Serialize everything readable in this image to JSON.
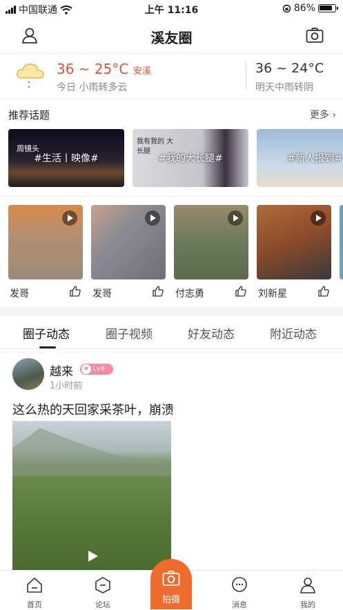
{
  "status": {
    "carrier": "中国联通",
    "time": "上午 11:16",
    "battery": "86%",
    "signal_icon": "signal-bars-icon",
    "wifi_icon": "wifi-icon"
  },
  "nav": {
    "title": "溪友圈"
  },
  "weather": {
    "today_temp": "36 ~ 25°C",
    "city": "安溪",
    "today_desc": "今日 小雨转多云",
    "tomorrow_temp": "36 ~ 24°C",
    "tomorrow_desc": "明天中雨转阴"
  },
  "topics_section": {
    "title": "推荐话题",
    "more": "更多"
  },
  "topics": [
    {
      "label": "#生活丨映像#",
      "overlay": "周镜头",
      "color": "#1a1a2a"
    },
    {
      "label": "#我的大长腿#",
      "overlay": "我有我的 大长腿",
      "color": "#cfcfd4"
    },
    {
      "label": "#新人报到#",
      "overlay": "",
      "color": "#7fa0c4"
    }
  ],
  "videos": [
    {
      "name": "发哥",
      "color": "#b9a68e"
    },
    {
      "name": "发哥",
      "color": "#8f8a86"
    },
    {
      "name": "付志勇",
      "color": "#7e8a6e"
    },
    {
      "name": "刘新星",
      "color": "#8a5a3a"
    }
  ],
  "tabs": [
    "圈子动态",
    "圈子视频",
    "好友动态",
    "附近动态"
  ],
  "post": {
    "user": "越来",
    "level": "Lv4",
    "time": "1小时前",
    "text": "这么热的天回家采茶叶，崩溃"
  },
  "tabbar": {
    "home": "首页",
    "forum": "论坛",
    "shoot": "拍摄",
    "messages": "消息",
    "mine": "我的"
  }
}
